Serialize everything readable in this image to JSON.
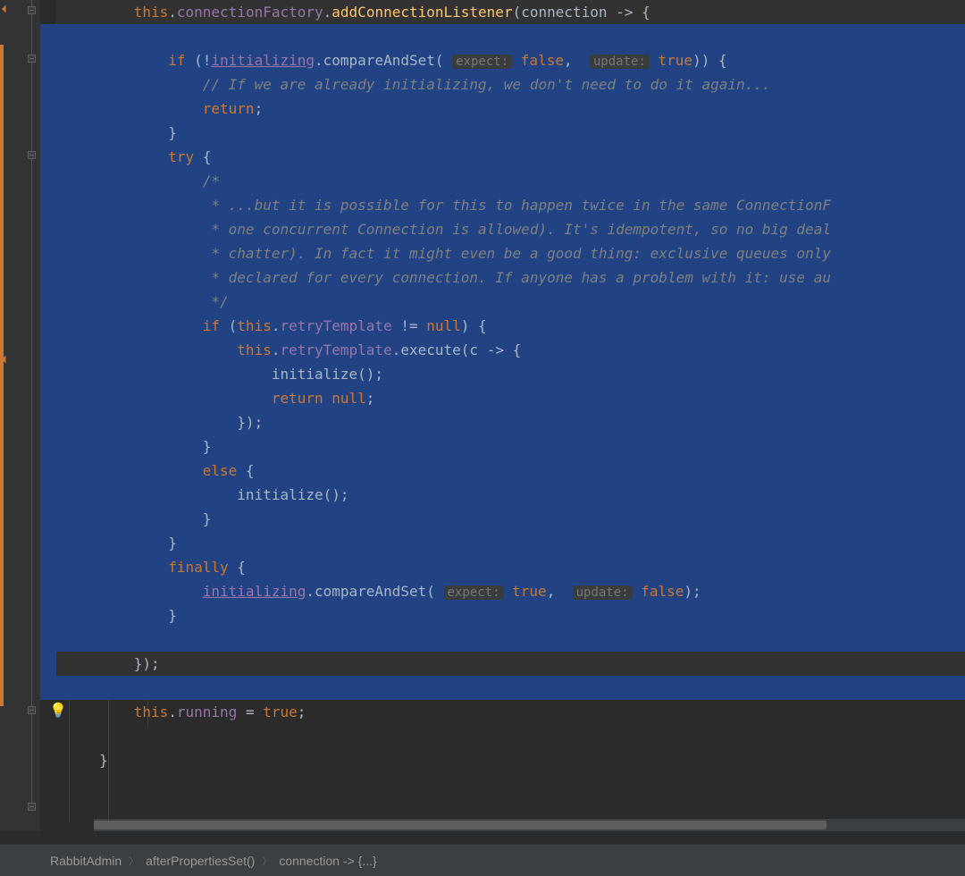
{
  "breadcrumb": {
    "items": [
      "RabbitAdmin",
      "afterPropertiesSet()",
      "connection -> {...}"
    ]
  },
  "code": {
    "l1": {
      "pre": "this",
      "dot1": ".",
      "fld1": "connectionFactory",
      "dot2": ".",
      "mth": "addConnectionListener",
      "op": "(",
      "arg": "connection",
      "lam": " -> {"
    },
    "l2": "",
    "l3": {
      "kw1": "if",
      "op1": " (!",
      "fld": "initializing",
      "dot": ".",
      "mth": "compareAndSet",
      "op2": "( ",
      "hint1": "expect:",
      "sp1": " ",
      "kw2": "false",
      "comma": ",  ",
      "hint2": "update:",
      "sp2": " ",
      "kw3": "true",
      "op3": ")) {"
    },
    "l4": {
      "cmt": "// If we are already initializing, we don't need to do it again..."
    },
    "l5": {
      "kw": "return",
      "semi": ";"
    },
    "l6": {
      "brace": "}"
    },
    "l7": {
      "kw": "try",
      "brace": " {"
    },
    "l8": {
      "cmt": "/*"
    },
    "l9": {
      "cmt": " * ...but it is possible for this to happen twice in the same ConnectionF"
    },
    "l10": {
      "cmt": " * one concurrent Connection is allowed). It's idempotent, so no big deal"
    },
    "l11": {
      "cmt": " * chatter). In fact it might even be a good thing: exclusive queues only"
    },
    "l12": {
      "cmt": " * declared for every connection. If anyone has a problem with it: use au"
    },
    "l13": {
      "cmt": " */"
    },
    "l14": {
      "kw1": "if",
      "op1": " (",
      "kw2": "this",
      "dot": ".",
      "fld": "retryTemplate",
      "op2": " != ",
      "kw3": "null",
      "op3": ") {"
    },
    "l15": {
      "kw": "this",
      "dot": ".",
      "fld": "retryTemplate",
      "dot2": ".",
      "mth": "execute",
      "op": "(",
      "arg": "c",
      "lam": " -> {"
    },
    "l16": {
      "mth": "initialize",
      "op": "();"
    },
    "l17": {
      "kw": "return null",
      "semi": ";"
    },
    "l18": {
      "brace": "});"
    },
    "l19": {
      "brace": "}"
    },
    "l20": {
      "kw": "else",
      "brace": " {"
    },
    "l21": {
      "mth": "initialize",
      "op": "();"
    },
    "l22": {
      "brace": "}"
    },
    "l23": {
      "brace": "}"
    },
    "l24": {
      "kw": "finally",
      "brace": " {"
    },
    "l25": {
      "fld": "initializing",
      "dot": ".",
      "mth": "compareAndSet",
      "op1": "( ",
      "hint1": "expect:",
      "sp1": " ",
      "kw1": "true",
      "comma": ",  ",
      "hint2": "update:",
      "sp2": " ",
      "kw2": "false",
      "op2": ");"
    },
    "l26": {
      "brace": "}"
    },
    "l27": "",
    "l28": {
      "brace": "});"
    },
    "l29": "",
    "l30": {
      "kw1": "this",
      "dot": ".",
      "fld": "running",
      "eq": " = ",
      "kw2": "true",
      "semi": ";"
    },
    "l31": "",
    "l32": {
      "brace": "}"
    }
  },
  "colors": {
    "bg": "#2b2b2b",
    "selection": "#214283",
    "keyword": "#cc7832",
    "method": "#ffc66d",
    "field": "#9876aa",
    "comment": "#808080"
  }
}
